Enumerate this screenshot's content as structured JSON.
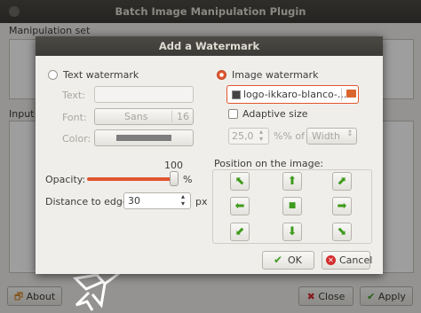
{
  "parent": {
    "title": "Batch Image Manipulation Plugin",
    "manipulation_set_label": "Manipulation set",
    "input_label": "Input f",
    "about_label": "About",
    "close_label": "Close",
    "apply_label": "Apply"
  },
  "dialog": {
    "title": "Add a Watermark",
    "text_watermark": {
      "label": "Text watermark",
      "selected": false,
      "text_label": "Text:",
      "text_value": "",
      "font_label": "Font:",
      "font_name": "Sans",
      "font_size": "16",
      "color_label": "Color:",
      "color_value": "#7d7d7d"
    },
    "image_watermark": {
      "label": "Image watermark",
      "selected": true,
      "file": "logo-ikkaro-blanco-...",
      "adaptive_label": "Adaptive size",
      "adaptive_checked": false,
      "size_value": "25,0",
      "percent_of": "%% of",
      "dimension": "Width"
    },
    "opacity": {
      "label": "Opacity:",
      "value": 100,
      "display": "100",
      "unit": "%"
    },
    "distance": {
      "label": "Distance to edge:",
      "value": "30",
      "unit": "px"
    },
    "position": {
      "label": "Position on the image:",
      "selected": "center",
      "cells": [
        "top-left",
        "top",
        "top-right",
        "left",
        "center",
        "right",
        "bottom-left",
        "bottom",
        "bottom-right"
      ]
    },
    "ok_label": "OK",
    "cancel_label": "Cancel"
  },
  "colors": {
    "accent": "#e1552e",
    "arrow": "#3f9b1c",
    "cancel_icon": "#d42d2d",
    "ok_icon": "#3f9b1c"
  }
}
